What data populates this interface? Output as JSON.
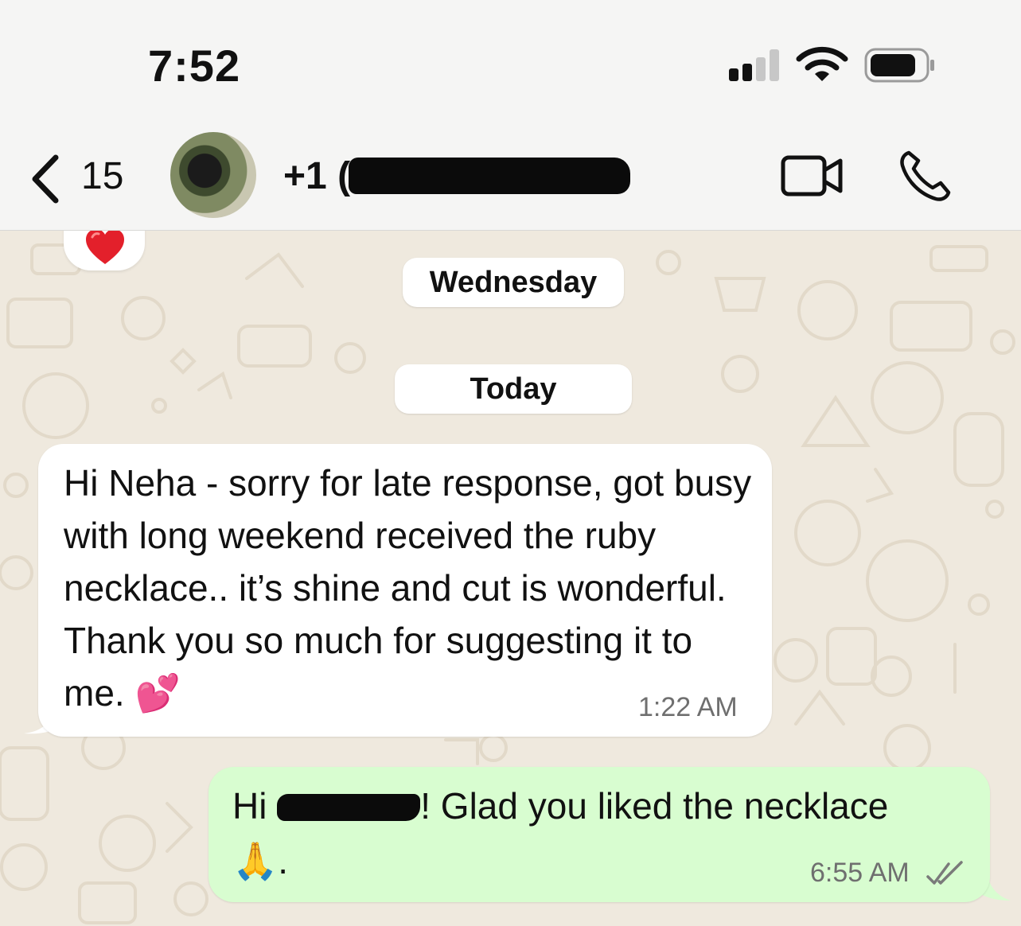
{
  "status_bar": {
    "time": "7:52",
    "icons": [
      "cellular-signal-icon",
      "wifi-icon",
      "battery-icon"
    ]
  },
  "header": {
    "back_icon": "chevron-left-icon",
    "back_count": "15",
    "contact_prefix": "+1 (4",
    "actions": [
      "video-call-icon",
      "voice-call-icon"
    ]
  },
  "chat": {
    "reaction": "❤️",
    "date_separators": [
      "Wednesday",
      "Today"
    ],
    "messages": [
      {
        "direction": "incoming",
        "text": "Hi Neha - sorry for late response, got busy with long weekend received the ruby necklace.. it’s shine and cut is wonderful. Thank you so much for suggesting it to me. 💕",
        "time": "1:22 AM"
      },
      {
        "direction": "outgoing",
        "text_before_redaction": "Hi ",
        "text_after_redaction": "! Glad you liked the necklace",
        "text_line2": "🙏.",
        "time": "6:55 AM",
        "status_icon": "double-check-read-icon"
      }
    ]
  },
  "colors": {
    "chat_background": "#efe9de",
    "incoming_bubble": "#ffffff",
    "outgoing_bubble": "#d8fdd0",
    "header_background": "#f5f5f4",
    "timestamp": "#6f6f6f"
  }
}
